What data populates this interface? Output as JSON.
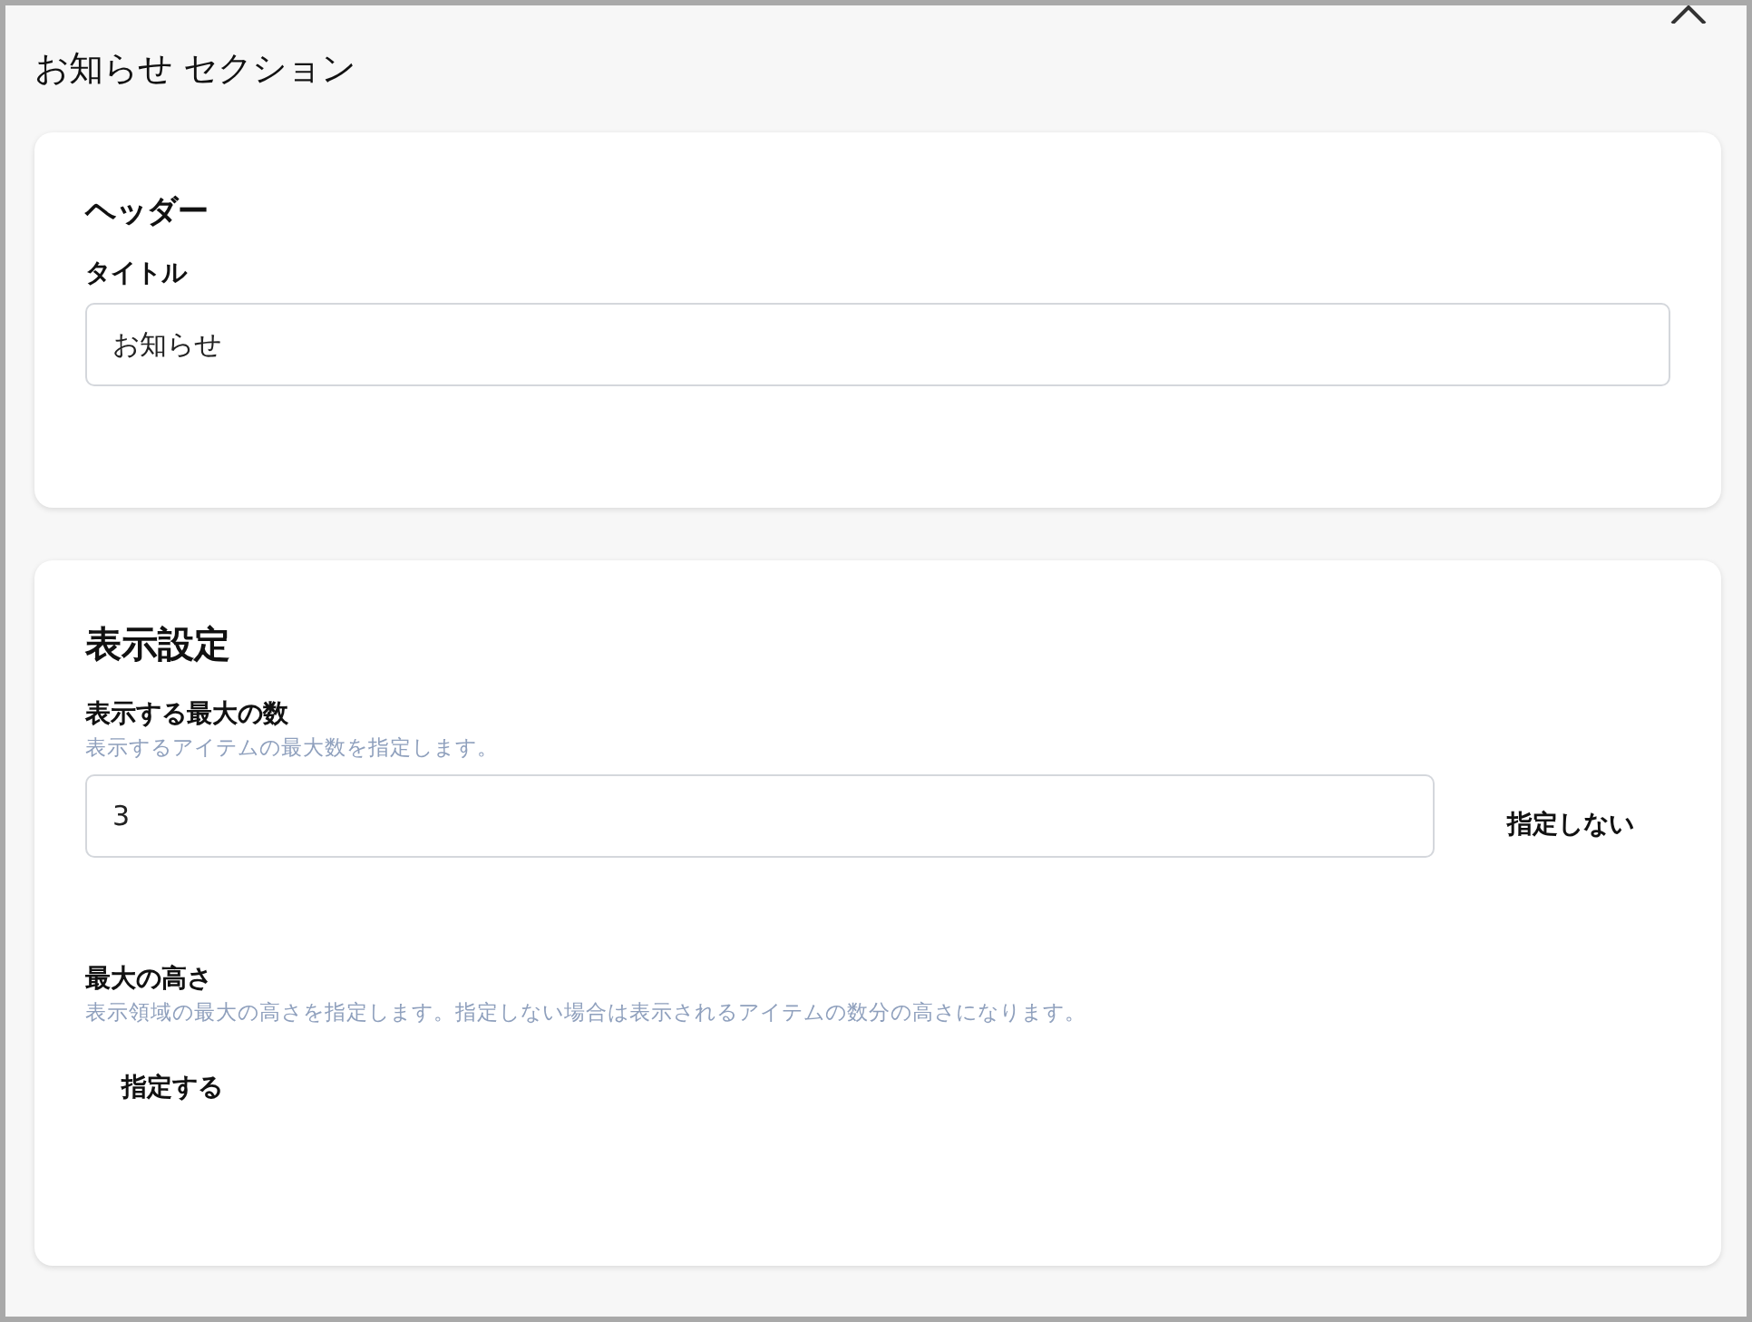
{
  "dialog": {
    "title": "お知らせ セクション"
  },
  "sections": [
    {
      "heading": "ヘッダー",
      "fields": [
        {
          "kind": "text",
          "label": "タイトル",
          "value": "お知らせ"
        }
      ]
    },
    {
      "heading": "表示設定",
      "fields": [
        {
          "kind": "number",
          "label": "表示する最大の数",
          "hint": "表示するアイテムの最大数を指定します。",
          "value": "3",
          "button": "指定しない"
        },
        {
          "kind": "toggle",
          "label": "最大の高さ",
          "hint": "表示領域の最大の高さを指定します。指定しない場合は表示されるアイテムの数分の高さになります。",
          "button": "指定する"
        }
      ]
    }
  ]
}
